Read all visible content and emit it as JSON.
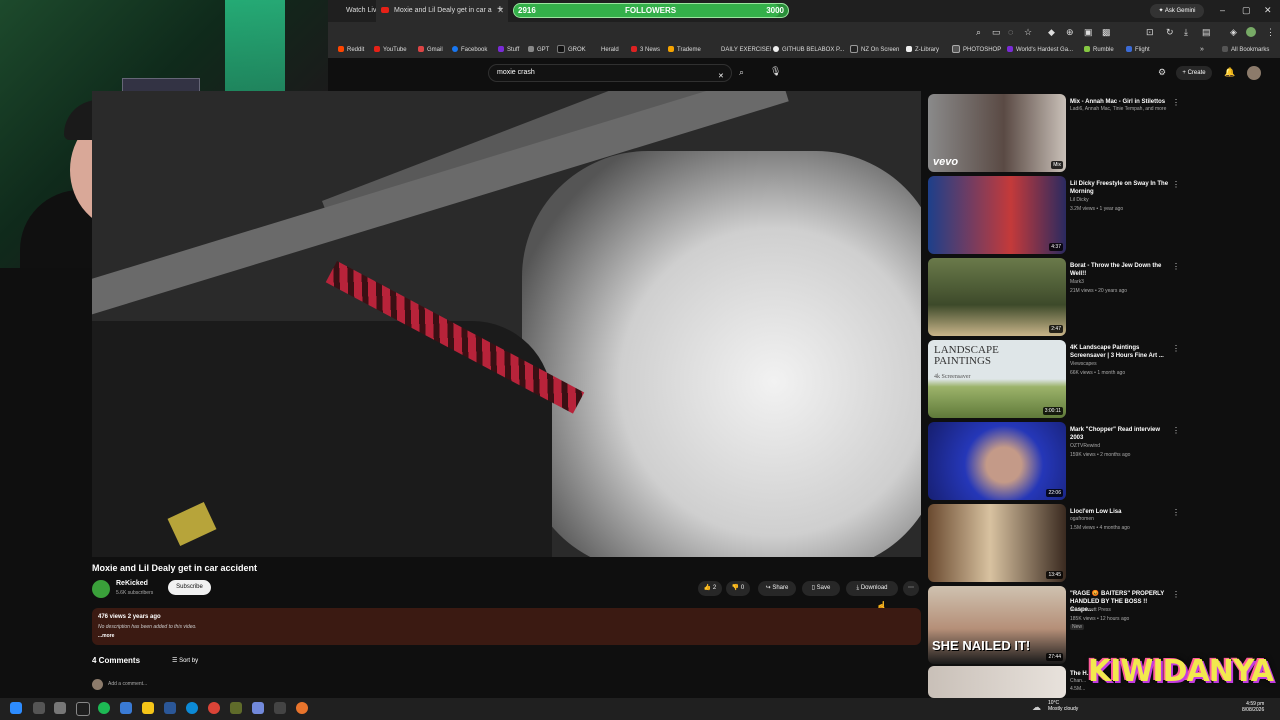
{
  "browser": {
    "tabs": [
      {
        "label": "Watch Liv",
        "active": false
      },
      {
        "label": "Moxie and Lil Dealy get in car a",
        "active": true
      }
    ],
    "new_tab_label": "+",
    "ask_gemini": "Ask Gemini",
    "all_bookmarks": "All Bookmarks",
    "bookmarks": [
      "Reddit",
      "YouTube",
      "Gmail",
      "Facebook",
      "Stuff",
      "GPT",
      "GROK",
      "Herald",
      "3 News",
      "Trademe",
      "DAILY EXERCISE!",
      "GITHUB BELABOX P...",
      "NZ On Screen",
      "Z-Library",
      "PHOTOSHOP",
      "World's Hardest Ga...",
      "Rumble",
      "Flight"
    ]
  },
  "followers_bar": {
    "current": "2916",
    "label": "FOLLOWERS",
    "goal": "3000",
    "progress": 0.972
  },
  "youtube": {
    "search_value": "moxie crash",
    "create_label": "Create",
    "video": {
      "title": "Moxie and Lil Dealy get in car accident",
      "channel": "ReKicked",
      "subscribers": "5.6K subscribers",
      "subscribe_label": "Subscribe",
      "likes": "2",
      "dislikes": "0",
      "share_label": "Share",
      "save_label": "Save",
      "download_label": "Download",
      "stats": "476 views  2 years ago",
      "description": "No description has been added to this video.",
      "more_label": "...more"
    },
    "comments": {
      "count_label": "4 Comments",
      "sort_label": "Sort by",
      "add_placeholder": "Add a comment..."
    },
    "recommendations": [
      {
        "title": "Mix - Annah Mac - Girl in Stilettos",
        "channel": "Ladi6, Annah Mac, Tinie Tempah, and more",
        "meta": "",
        "duration": "Mix",
        "thumb_text": "vevo"
      },
      {
        "title": "Lil Dicky Freestyle on Sway In The Morning",
        "channel": "Lil Dicky",
        "meta": "3.2M views • 1 year ago",
        "duration": "4:37",
        "thumb_text": ""
      },
      {
        "title": "Borat - Throw the Jew Down the Well!!",
        "channel": "Mark3",
        "meta": "21M views • 20 years ago",
        "duration": "2:47",
        "thumb_text": ""
      },
      {
        "title": "4K Landscape Paintings Screensaver | 3 Hours Fine Art ...",
        "channel": "Viewscapes",
        "meta": "66K views • 1 month ago",
        "duration": "3:00:11",
        "thumb_text": "LANDSCAPE PAINTINGS",
        "thumb_sub": "4k Screensaver"
      },
      {
        "title": "Mark \"Chopper\" Read interview 2003",
        "channel": "OZTVRewind",
        "meta": "159K views • 2 months ago",
        "duration": "22:06",
        "thumb_text": ""
      },
      {
        "title": "Llocl'em Low Lisa",
        "channel": "ogafromen",
        "meta": "1.5M views • 4 months ago",
        "duration": "13:45",
        "thumb_text": ""
      },
      {
        "title": "\"RAGE 😡 BAITERS\" PROPERLY HANDLED BY THE BOSS !! Caspe...",
        "channel": "Amagansett Press",
        "meta": "185K views • 12 hours ago",
        "badge": "New",
        "duration": "27:44",
        "thumb_text": "SHE NAILED IT!"
      },
      {
        "title": "The H...",
        "channel": "Chan...",
        "meta": "4.5M...",
        "duration": "",
        "thumb_text": ""
      }
    ]
  },
  "taskbar": {
    "weather_temp": "10°C",
    "weather_desc": "Mostly cloudy",
    "time": "4:59 pm",
    "date": "8/08/2026"
  },
  "overlay_logo": "KIWIDANYA"
}
